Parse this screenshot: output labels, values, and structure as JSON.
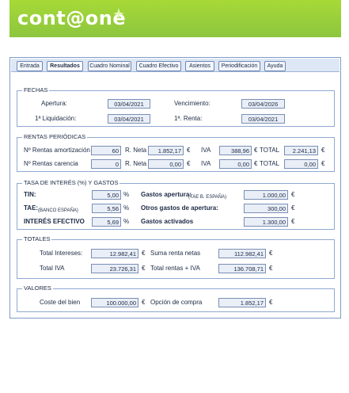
{
  "logo": {
    "text": "cont@one",
    "accent_color": "#ffffff",
    "brand_color": "#8cc63f"
  },
  "tabs": [
    {
      "label": "Entrada"
    },
    {
      "label": "Resultados"
    },
    {
      "label": "Cuadro Nominal"
    },
    {
      "label": "Cuadro Efectivo"
    },
    {
      "label": "Asientos"
    },
    {
      "label": "Periodificación"
    },
    {
      "label": "Ayuda"
    }
  ],
  "fechas": {
    "title": "FECHAS",
    "apertura_label": "Apertura:",
    "apertura": "03/04/2021",
    "vencimiento_label": "Vencimiento:",
    "vencimiento": "03/04/2026",
    "liquidacion_label": "1ª Liquidación:",
    "liquidacion": "03/04/2021",
    "renta_label": "1ª. Renta:",
    "renta": "03/04/2021"
  },
  "rentas": {
    "title": "RENTAS PERIÓDICAS",
    "amortizacion_label": "Nº Rentas amortización",
    "amortizacion": "60",
    "carencia_label": "Nº Rentas carencia",
    "carencia": "0",
    "rneta_label": "R. Neta",
    "rneta1": "1.852,17",
    "rneta2": "0,00",
    "iva_label": "IVA",
    "iva1": "388,96",
    "iva2": "0,00",
    "total_label": "TOTAL",
    "total1": "2.241,13",
    "total2": "0,00",
    "euro": "€"
  },
  "tasa": {
    "title": "TASA DE INTERÉS (%) Y GASTOS",
    "tin_label": "TIN:",
    "tin": "5,00",
    "tae_label": "TAE:",
    "tae_sub": "(BANCO ESPAÑA)",
    "tae": "5,56",
    "ie_label": "INTERÉS EFECTIVO",
    "ie": "5,69",
    "pct": "%",
    "gastos_apertura_label": "Gastos apertura:",
    "gastos_apertura_sub": "(TAE B. ESPAÑA)",
    "gastos_apertura": "1.000,00",
    "otros_label": "Otros gastos de apertura:",
    "otros": "300,00",
    "activados_label": "Gastos activados",
    "activados": "1.300,00",
    "euro": "€"
  },
  "totales": {
    "title": "TOTALES",
    "intereses_label": "Total Intereses:",
    "intereses": "12.982,41",
    "iva_label": "Total IVA",
    "iva": "23.726,31",
    "suma_label": "Suma renta netas",
    "suma": "112.982,41",
    "rentas_iva_label": "Total rentas + IVA",
    "rentas_iva": "136.708,71",
    "euro": "€"
  },
  "valores": {
    "title": "VALORES",
    "coste_label": "Coste del bien",
    "coste": "100.000,00",
    "opcion_label": "Opción de compra",
    "opcion": "1.852,17",
    "euro": "€"
  }
}
